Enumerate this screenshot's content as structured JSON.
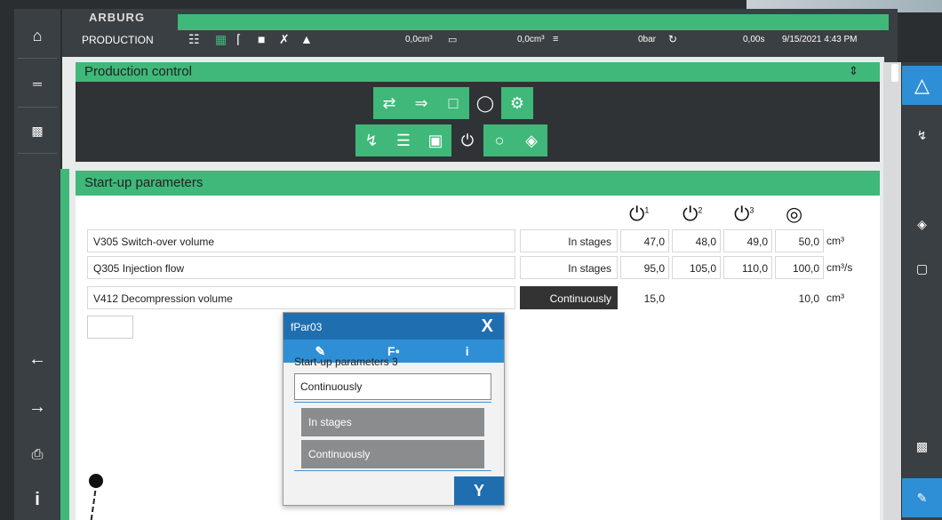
{
  "header": {
    "logo": "ARBURG",
    "mode": "PRODUCTION",
    "volume1": "0,0cm³",
    "volume2": "0,0cm³",
    "pressure": "0bar",
    "time": "0,00s",
    "datetime": "9/15/2021 4:43 PM"
  },
  "leftnav": {
    "home_icon": "home-icon",
    "menu_icon": "menu-icon",
    "machine_icon": "machine-icon",
    "back_icon": "arrow-left-icon",
    "forward_icon": "arrow-right-icon",
    "print_icon": "print-icon",
    "info_icon": "info-icon"
  },
  "production_control": {
    "title": "Production control"
  },
  "startup": {
    "title": "Start-up parameters",
    "rows": [
      {
        "label": "V305 Switch-over volume",
        "mode": "In stages",
        "v1": "47,0",
        "v2": "48,0",
        "v3": "49,0",
        "v4": "50,0",
        "unit": "cm³"
      },
      {
        "label": "Q305 Injection flow",
        "mode": "In stages",
        "v1": "95,0",
        "v2": "105,0",
        "v3": "110,0",
        "v4": "100,0",
        "unit": "cm³/s"
      },
      {
        "label": "V412 Decompression volume",
        "mode": "Continuously",
        "v1": "15,0",
        "v2": "",
        "v3": "",
        "v4": "10,0",
        "unit": "cm³"
      }
    ],
    "col_labels": [
      "1",
      "2",
      "3"
    ]
  },
  "dialog": {
    "title": "fPar03",
    "close": "X",
    "tab_f": "F",
    "tab_i": "i",
    "subtitle": "Start-up parameters 3",
    "value": "Continuously",
    "options": [
      "In stages",
      "Continuously"
    ],
    "confirm": "Y"
  }
}
